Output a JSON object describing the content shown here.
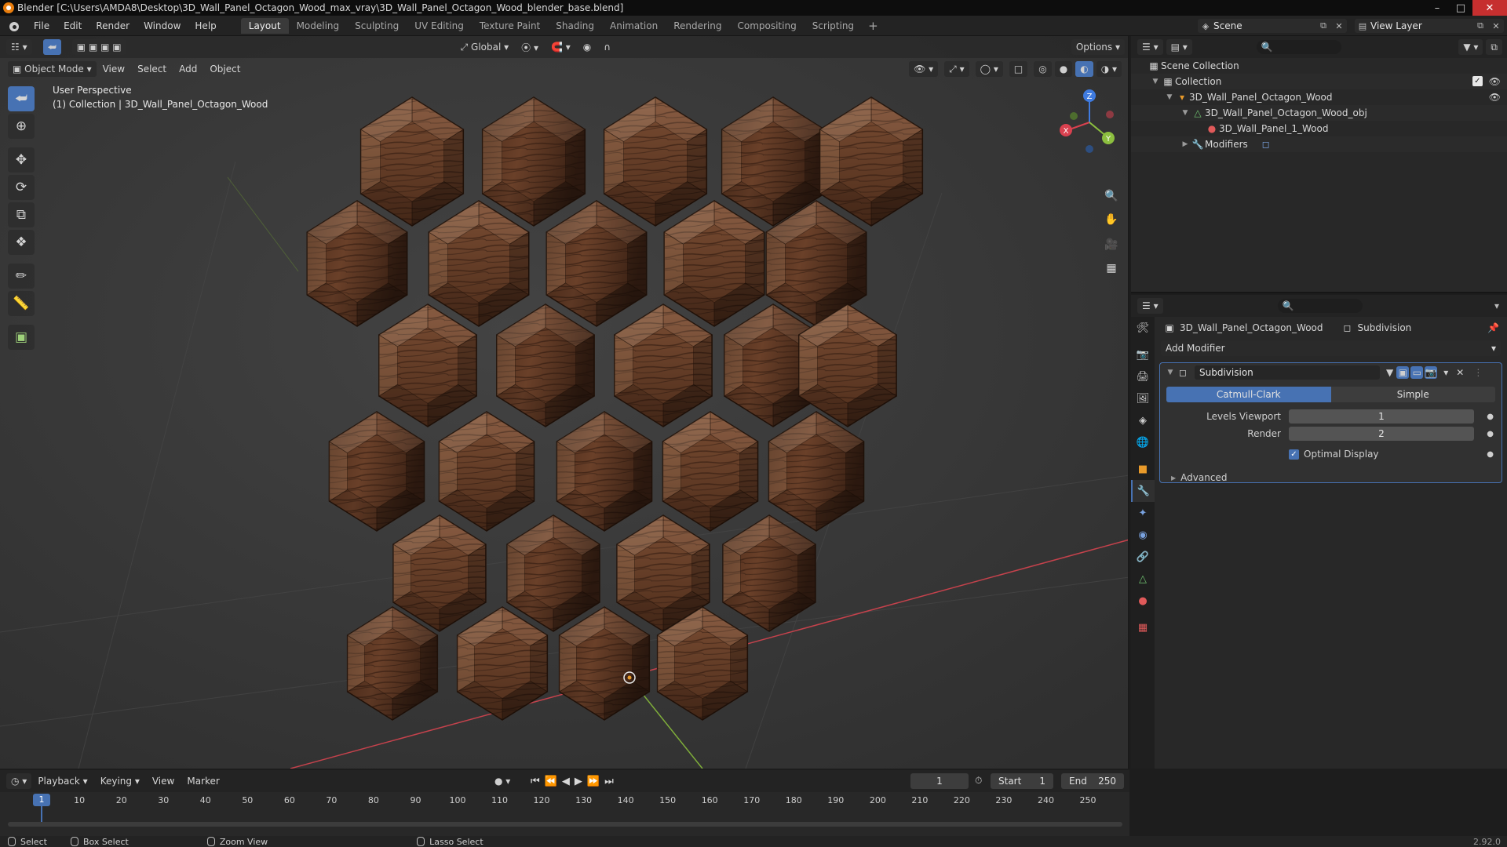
{
  "window": {
    "title": "Blender [C:\\Users\\AMDA8\\Desktop\\3D_Wall_Panel_Octagon_Wood_max_vray\\3D_Wall_Panel_Octagon_Wood_blender_base.blend]"
  },
  "menu": [
    "File",
    "Edit",
    "Render",
    "Window",
    "Help"
  ],
  "workspaces": [
    "Layout",
    "Modeling",
    "Sculpting",
    "UV Editing",
    "Texture Paint",
    "Shading",
    "Animation",
    "Rendering",
    "Compositing",
    "Scripting"
  ],
  "scene": {
    "label": "Scene"
  },
  "view_layer": {
    "label": "View Layer"
  },
  "viewport": {
    "transform_orientation": "Global",
    "options_label": "Options",
    "mode": "Object Mode",
    "header_menus": [
      "View",
      "Select",
      "Add",
      "Object"
    ],
    "overlay_title": "User Perspective",
    "overlay_subtitle": "(1) Collection | 3D_Wall_Panel_Octagon_Wood",
    "gizmo_axes": [
      "X",
      "Y",
      "Z"
    ]
  },
  "outliner": {
    "root": "Scene Collection",
    "rows": [
      {
        "label": "Collection"
      },
      {
        "label": "3D_Wall_Panel_Octagon_Wood"
      },
      {
        "label": "3D_Wall_Panel_Octagon_Wood_obj"
      },
      {
        "label": "3D_Wall_Panel_1_Wood"
      },
      {
        "label": "Modifiers"
      }
    ]
  },
  "properties": {
    "object_name": "3D_Wall_Panel_Octagon_Wood",
    "modifier_crumb": "Subdivision",
    "add_modifier": "Add Modifier",
    "modifier": {
      "name": "Subdivision",
      "type_options": [
        "Catmull-Clark",
        "Simple"
      ],
      "selected_type": "Catmull-Clark",
      "levels_viewport_label": "Levels Viewport",
      "levels_viewport": "1",
      "render_label": "Render",
      "render": "2",
      "optimal_display_label": "Optimal Display",
      "optimal_display": true,
      "advanced_label": "Advanced"
    }
  },
  "timeline": {
    "menus": [
      "Playback",
      "Keying",
      "View",
      "Marker"
    ],
    "current_frame": "1",
    "start_label": "Start",
    "start": "1",
    "end_label": "End",
    "end": "250",
    "ticks": [
      "1",
      "10",
      "20",
      "30",
      "40",
      "50",
      "60",
      "70",
      "80",
      "90",
      "100",
      "110",
      "120",
      "130",
      "140",
      "150",
      "160",
      "170",
      "180",
      "190",
      "200",
      "210",
      "220",
      "230",
      "240",
      "250"
    ]
  },
  "status": {
    "select": "Select",
    "box_select": "Box Select",
    "zoom_view": "Zoom View",
    "lasso_select": "Lasso Select",
    "version": "2.92.0"
  },
  "colors": {
    "accent": "#4772b3",
    "wood_dark": "#3a2114",
    "wood_mid": "#5a3522",
    "wood_light": "#7a4d33",
    "axis_x": "#d9414f",
    "axis_y": "#8cbf3f",
    "axis_z": "#3f7be0"
  }
}
